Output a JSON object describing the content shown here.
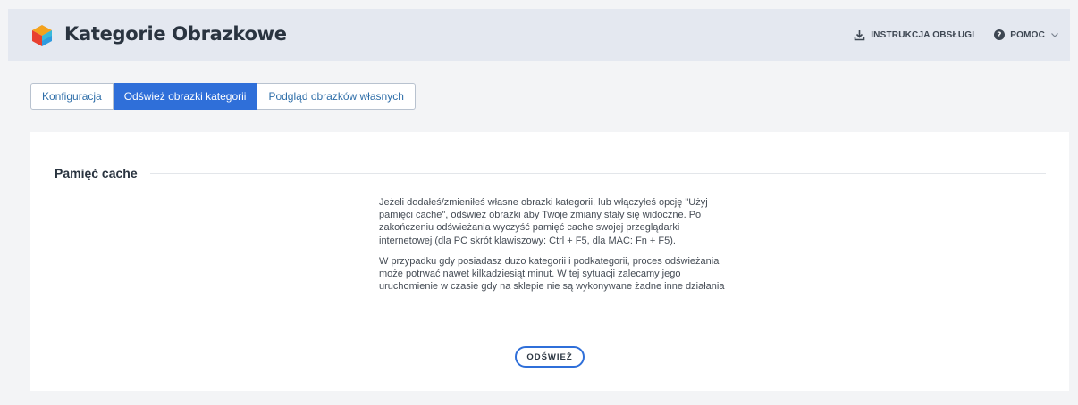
{
  "header": {
    "title": "Kategorie Obrazkowe",
    "actions": [
      {
        "label": "INSTRUKCJA OBSŁUGI",
        "icon": "download-icon"
      },
      {
        "label": "POMOC",
        "icon": "help-circle-icon"
      }
    ]
  },
  "tabs": [
    {
      "label": "Konfiguracja",
      "active": false
    },
    {
      "label": "Odśwież obrazki kategorii",
      "active": true
    },
    {
      "label": "Podgląd obrazków własnych",
      "active": false
    }
  ],
  "section": {
    "title": "Pamięć cache",
    "paragraphs": [
      "Jeżeli dodałeś/zmieniłeś własne obrazki kategorii, lub włączyłeś opcję \"Użyj pamięci cache\", odśwież obrazki aby Twoje zmiany stały się widoczne. Po zakończeniu odświeżania wyczyść pamięć cache swojej przeglądarki internetowej (dla PC skrót klawiszowy: Ctrl + F5, dla MAC: Fn + F5).",
      "W przypadku gdy posiadasz dużo kategorii i podkategorii, proces odświeżania może potrwać nawet kilkadziesiąt minut. W tej sytuacji zalecamy jego uruchomienie w czasie gdy na sklepie nie są wykonywane żadne inne działania"
    ],
    "button_label": "ODŚWIEŻ"
  },
  "colors": {
    "accent": "#2f6fd9",
    "header_bg": "#e4e8f0",
    "page_bg": "#f3f4f6"
  }
}
